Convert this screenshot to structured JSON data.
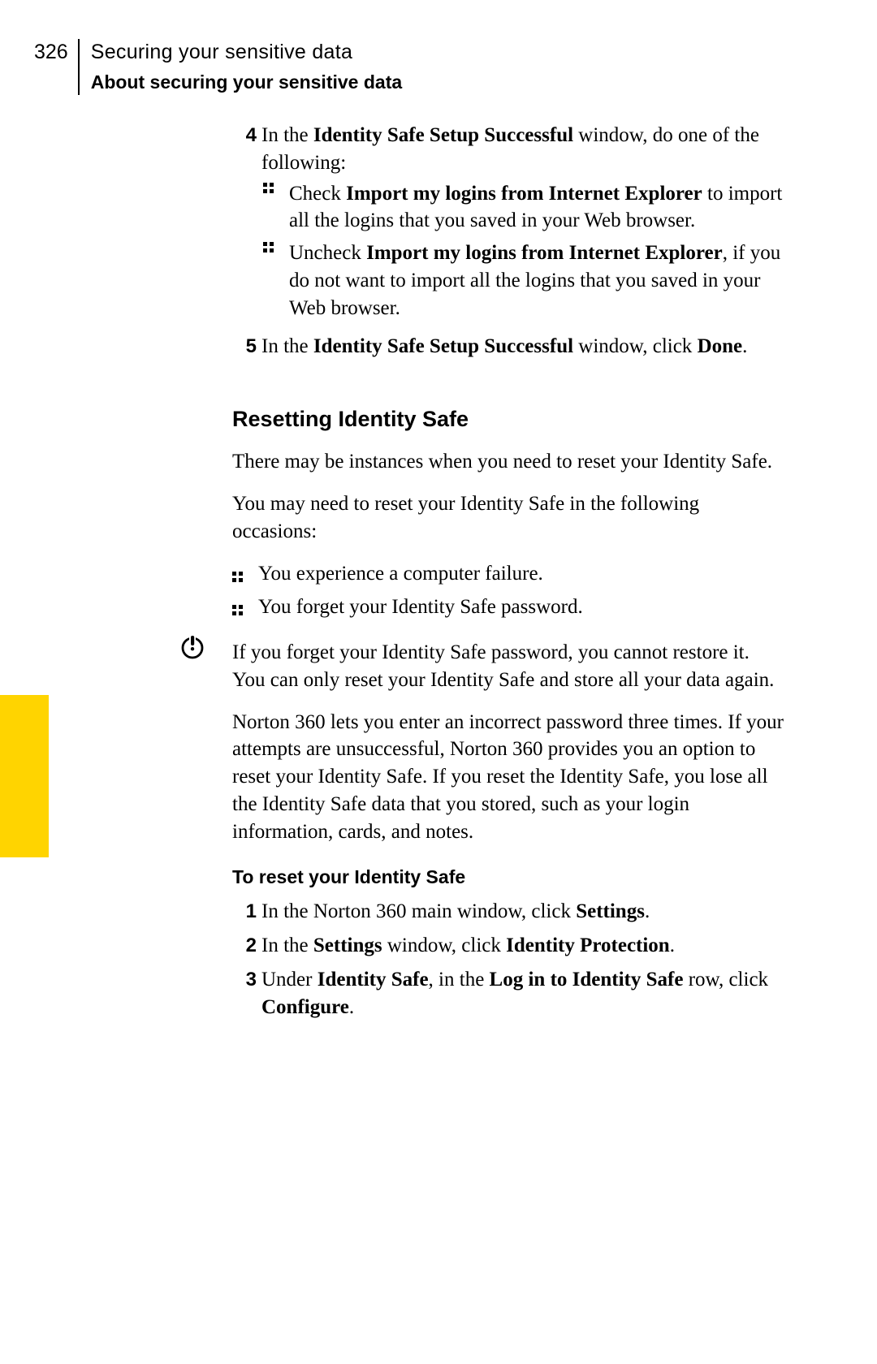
{
  "header": {
    "page_number": "326",
    "chapter_title": "Securing your sensitive data",
    "section_title": "About securing your sensitive data"
  },
  "step4": {
    "num": "4",
    "intro_plain1": "In the ",
    "intro_bold": "Identity Safe Setup Successful",
    "intro_plain2": " window, do one of the following:",
    "bullet1_lead": "Check ",
    "bullet1_bold": "Import my logins from Internet Explorer",
    "bullet1_tail": " to import all the logins that you saved in your Web browser.",
    "bullet2_lead": "Uncheck ",
    "bullet2_bold": "Import my logins from Internet Explorer",
    "bullet2_tail": ", if you do not want to import all the logins that you saved in your Web browser."
  },
  "step5": {
    "num": "5",
    "plain1": "In the ",
    "bold1": "Identity Safe Setup Successful",
    "plain2": " window, click ",
    "bold2": "Done",
    "plain3": "."
  },
  "h2_reset": "Resetting Identity Safe",
  "p_reset1": "There may be instances when you need to reset your Identity Safe.",
  "p_reset2": "You may need to reset your Identity Safe in the following occasions:",
  "reasons": {
    "r1": "You experience a computer failure.",
    "r2": "You forget your Identity Safe password."
  },
  "p_warn": "If you forget your Identity Safe password, you cannot restore it. You can only reset your Identity Safe and store all your data again.",
  "p_norton": "Norton 360 lets you enter an incorrect password three times. If your attempts are unsuccessful, Norton 360 provides you an option to reset your Identity Safe. If you reset the Identity Safe, you lose all the Identity Safe data that you stored, such as your login information, cards, and notes.",
  "h3_reset": "To reset your Identity Safe",
  "rstep1": {
    "num": "1",
    "p1": "In the Norton 360 main window, click ",
    "b1": "Settings",
    "p2": "."
  },
  "rstep2": {
    "num": "2",
    "p1": "In the ",
    "b1": "Settings",
    "p2": " window, click ",
    "b2": "Identity Protection",
    "p3": "."
  },
  "rstep3": {
    "num": "3",
    "p1": "Under ",
    "b1": "Identity Safe",
    "p2": ", in the ",
    "b2": "Log in to Identity Safe",
    "p3": " row, click ",
    "b3": "Configure",
    "p4": "."
  }
}
